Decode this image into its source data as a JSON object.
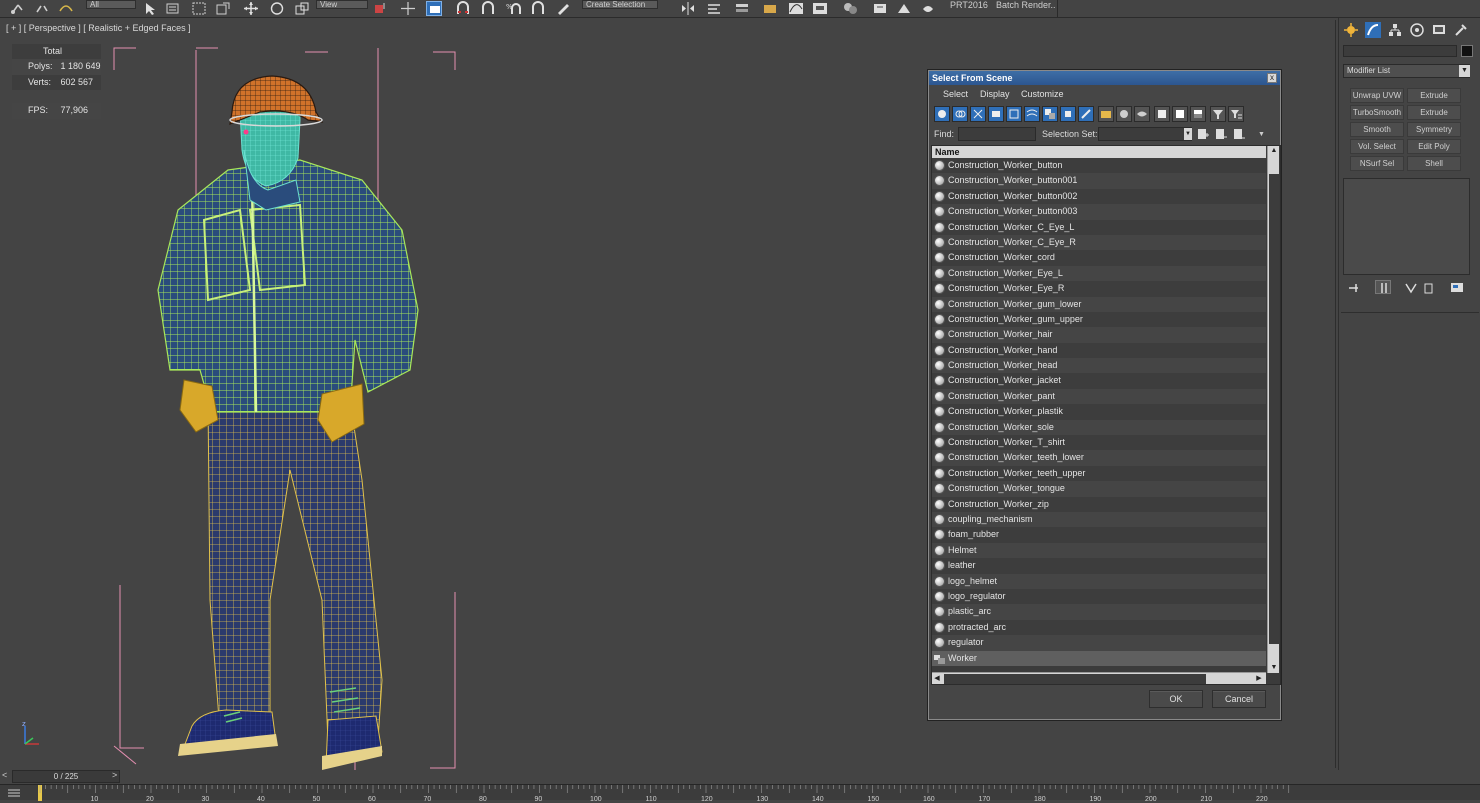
{
  "toolbar": {
    "selection_filter": "All",
    "view_dropdown": "View",
    "create_selection_set": "Create Selection Se",
    "prt_label": "PRT2016",
    "batch_render": "Batch Render.."
  },
  "viewport": {
    "label": "[ + ] [ Perspective ] [ Realistic + Edged Faces ]",
    "stats": {
      "total_label": "Total",
      "polys_label": "Polys:",
      "polys_value": "1 180 649",
      "verts_label": "Verts:",
      "verts_value": "602 567",
      "fps_label": "FPS:",
      "fps_value": "77,906"
    }
  },
  "command_panel": {
    "modifier_list": "Modifier List",
    "buttons": [
      "Unwrap UVW",
      "Extrude",
      "TurboSmooth",
      "Extrude",
      "Smooth",
      "Symmetry",
      "Vol. Select",
      "Edit Poly",
      "NSurf Sel",
      "Shell"
    ]
  },
  "dialog": {
    "title": "Select From Scene",
    "close_label": "x",
    "menu": [
      "Select",
      "Display",
      "Customize"
    ],
    "find_label": "Find:",
    "selection_set_label": "Selection Set:",
    "column_name": "Name",
    "items": [
      "Construction_Worker_button",
      "Construction_Worker_button001",
      "Construction_Worker_button002",
      "Construction_Worker_button003",
      "Construction_Worker_C_Eye_L",
      "Construction_Worker_C_Eye_R",
      "Construction_Worker_cord",
      "Construction_Worker_Eye_L",
      "Construction_Worker_Eye_R",
      "Construction_Worker_gum_lower",
      "Construction_Worker_gum_upper",
      "Construction_Worker_hair",
      "Construction_Worker_hand",
      "Construction_Worker_head",
      "Construction_Worker_jacket",
      "Construction_Worker_pant",
      "Construction_Worker_plastik",
      "Construction_Worker_sole",
      "Construction_Worker_T_shirt",
      "Construction_Worker_teeth_lower",
      "Construction_Worker_teeth_upper",
      "Construction_Worker_tongue",
      "Construction_Worker_zip",
      "coupling_mechanism",
      "foam_rubber",
      "Helmet",
      "leather",
      "logo_helmet",
      "logo_regulator",
      "plastic_arc",
      "protracted_arc",
      "regulator",
      "Worker"
    ],
    "selected_item": "Worker",
    "ok_label": "OK",
    "cancel_label": "Cancel"
  },
  "timeline": {
    "frame_display": "0 / 225",
    "prev_label": "<",
    "next_label": ">",
    "ticks": [
      "10",
      "20",
      "30",
      "40",
      "50",
      "60",
      "70",
      "80",
      "90",
      "100",
      "110",
      "120",
      "130",
      "140",
      "150",
      "160",
      "170",
      "180",
      "190",
      "200",
      "210",
      "220"
    ]
  },
  "colors": {
    "viewport_bg": "#444444",
    "stats_text": "#f2d24a",
    "dialog_title": "#2c5690",
    "bounding_box": "#e48fb0",
    "jacket_wire": "#9be04a",
    "pants_wire": "#e6c84a",
    "pants_fill": "#2d3d70"
  }
}
